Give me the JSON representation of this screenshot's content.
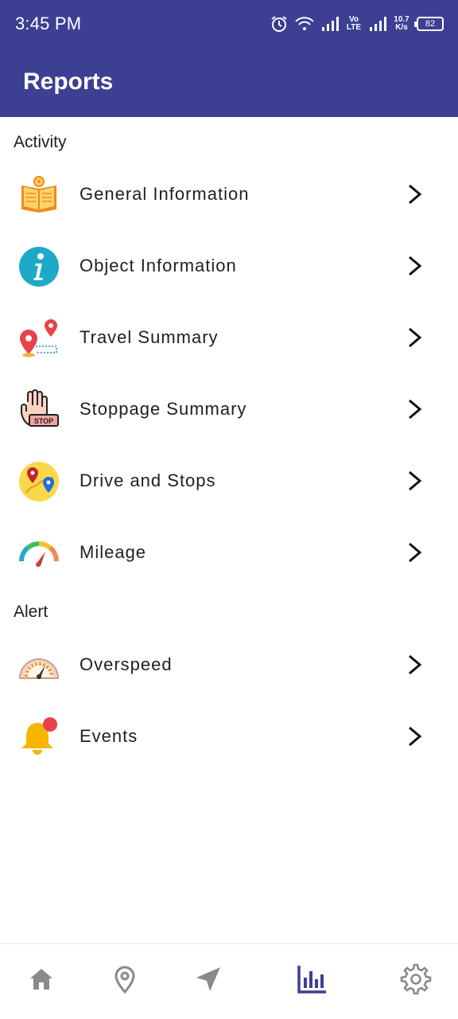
{
  "status_bar": {
    "time": "3:45 PM",
    "network_type": "Vo LTE",
    "speed_value": "10.7",
    "speed_unit": "K/s",
    "battery": "82"
  },
  "app_bar": {
    "title": "Reports"
  },
  "sections": [
    {
      "header": "Activity",
      "items": [
        {
          "label": "General Information",
          "icon": "book-icon"
        },
        {
          "label": "Object Information",
          "icon": "info-icon"
        },
        {
          "label": "Travel Summary",
          "icon": "route-pins-icon"
        },
        {
          "label": "Stoppage Summary",
          "icon": "stop-hand-icon"
        },
        {
          "label": "Drive and Stops",
          "icon": "map-pins-icon"
        },
        {
          "label": "Mileage",
          "icon": "gauge-icon"
        }
      ]
    },
    {
      "header": "Alert",
      "items": [
        {
          "label": "Overspeed",
          "icon": "speedometer-icon"
        },
        {
          "label": "Events",
          "icon": "bell-icon"
        }
      ]
    }
  ],
  "bottom_nav": {
    "items": [
      "home-icon",
      "location-pin-icon",
      "navigation-arrow-icon",
      "reports-chart-icon",
      "settings-gear-icon"
    ],
    "active": "reports-chart-icon"
  },
  "colors": {
    "primary": "#3c3f92",
    "inactive_nav": "#8a8a8a",
    "text": "#1f1f1f"
  }
}
